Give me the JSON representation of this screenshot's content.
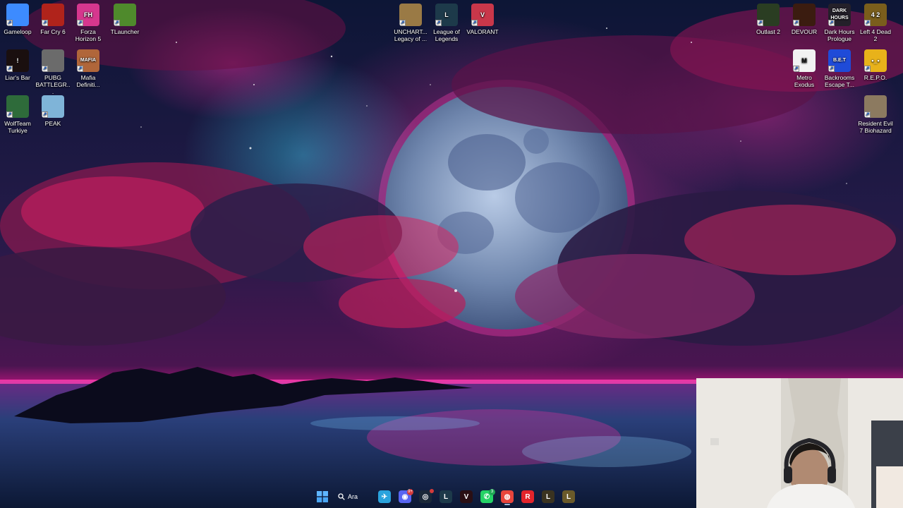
{
  "desktop_icons": [
    {
      "label": "Gameloop",
      "icon": "gameloop-icon",
      "color": "#3d8bff"
    },
    {
      "label": "Far Cry 6",
      "icon": "far-cry-6-icon",
      "color": "#b0231b"
    },
    {
      "label": "Forza Horizon 5",
      "icon": "forza-horizon-5-icon",
      "color": "#d6378e",
      "mark": "FH"
    },
    {
      "label": "TLauncher",
      "icon": "tlauncher-icon",
      "color": "#4f8a2c"
    },
    {
      "label": "UNCHART... Legacy of ...",
      "icon": "uncharted-icon",
      "color": "#9a7a45"
    },
    {
      "label": "League of Legends",
      "icon": "league-of-legends-icon",
      "color": "#1d3a4a",
      "mark": "L"
    },
    {
      "label": "VALORANT",
      "icon": "valorant-icon",
      "color": "#c9374a",
      "mark": "V"
    },
    {
      "label": "Outlast 2",
      "icon": "outlast-2-icon",
      "color": "#2a3d22"
    },
    {
      "label": "DEVOUR",
      "icon": "devour-icon",
      "color": "#3b1c10"
    },
    {
      "label": "Dark Hours Prologue",
      "icon": "dark-hours-icon",
      "color": "#24202a",
      "mark": "DARK HOURS"
    },
    {
      "label": "Left 4 Dead 2",
      "icon": "left-4-dead-2-icon",
      "color": "#7a5e1c",
      "mark": "4 2"
    },
    {
      "label": "Liar's Bar",
      "icon": "liars-bar-icon",
      "color": "#1a0f0f",
      "mark": "!"
    },
    {
      "label": "PUBG BATTLEGR...",
      "icon": "pubg-icon",
      "color": "#6b6b6b"
    },
    {
      "label": "Mafia Definiti...",
      "icon": "mafia-icon",
      "color": "#b0663a",
      "mark": "MAFIA"
    },
    {
      "label": "Metro Exodus",
      "icon": "metro-exodus-icon",
      "color": "#f2f2f2",
      "mark": "M"
    },
    {
      "label": "Backrooms Escape T...",
      "icon": "backrooms-icon",
      "color": "#1f4bd8",
      "mark": "B.E.T"
    },
    {
      "label": "R.E.P.O.",
      "icon": "repo-icon",
      "color": "#e8b21a",
      "mark": "•_•"
    },
    {
      "label": "WolfTeam Turkiye",
      "icon": "wolfteam-icon",
      "color": "#2e6b3a"
    },
    {
      "label": "PEAK",
      "icon": "peak-icon",
      "color": "#7fb4d8"
    },
    {
      "label": "Resident Evil 7 Biohazard",
      "icon": "resident-evil-7-icon",
      "color": "#8c7a60"
    }
  ],
  "taskbar": {
    "search_label": "Ara",
    "apps": [
      {
        "name": "telegram",
        "icon": "telegram-icon",
        "color": "#2aa3dd",
        "glyph": "✈"
      },
      {
        "name": "discord",
        "icon": "discord-icon",
        "color": "#5865f2",
        "glyph": "◉",
        "badge": "9+"
      },
      {
        "name": "steam",
        "icon": "steam-icon",
        "color": "#1b2838",
        "glyph": "◎",
        "badge_dot": true
      },
      {
        "name": "league-client",
        "icon": "league-client-icon",
        "color": "#1d3a4a",
        "glyph": "L"
      },
      {
        "name": "valorant",
        "icon": "valorant-taskbar-icon",
        "color": "#2a0f14",
        "glyph": "V"
      },
      {
        "name": "whatsapp",
        "icon": "whatsapp-icon",
        "color": "#25d366",
        "glyph": "✆",
        "badge": "3",
        "badge_color": "#1fa855"
      },
      {
        "name": "chrome",
        "icon": "chrome-icon",
        "color": "#e8453c",
        "glyph": "◍",
        "active": true
      },
      {
        "name": "riot-client",
        "icon": "riot-client-icon",
        "color": "#e3242b",
        "glyph": "R"
      },
      {
        "name": "league-alt",
        "icon": "league-alt-icon",
        "color": "#3a3320",
        "glyph": "L"
      },
      {
        "name": "league-folder",
        "icon": "league-folder-icon",
        "color": "#6a5a2a",
        "glyph": "L"
      }
    ]
  }
}
